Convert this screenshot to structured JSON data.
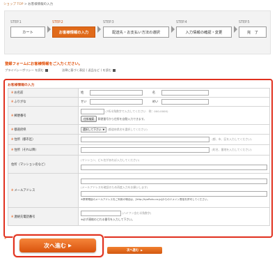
{
  "breadcrumb": {
    "home": "ショップ TOP",
    "separator": " > ",
    "current": "お客様情報の入力"
  },
  "steps": [
    {
      "num": "STEP.1",
      "label": "カート"
    },
    {
      "num": "STEP.2",
      "label": "お客様情報の入力"
    },
    {
      "num": "STEP.3",
      "label": "配送先・お支払い方法の選択"
    },
    {
      "num": "STEP.4",
      "label": "入力情報の確認・変更"
    },
    {
      "num": "STEP.5",
      "label": "完　了"
    }
  ],
  "intro": "登録フォームにお客様情報をご入力ください。",
  "links": {
    "privacy": "プライバシーポリシー を読む",
    "law": "法律に基づく表記 ( 返品など ) を読む"
  },
  "form": {
    "title": "お客様情報の入力",
    "required_mark": "※",
    "name": {
      "label": "お名前",
      "sei": "姓",
      "mei": "名"
    },
    "furigana": {
      "label": "ふりがな",
      "sei": "せい",
      "mei": "めい"
    },
    "zip": {
      "label": "郵便番号",
      "note": "(7桁半角数字で入力してください　例：000-0000)",
      "button": "住所検索",
      "button_note": "郵便番号から住所を自動入力できます。"
    },
    "pref": {
      "label": "都道府県",
      "select": "選択して下さい",
      "note": "(都道府県名を選択してください)"
    },
    "addr1": {
      "label": "住所（都市区）",
      "note": "(都、市、区を入力してください)"
    },
    "addr2": {
      "label": "住所（それ以降）",
      "note": "(町名、番地を入力してください)"
    },
    "building": {
      "label": "住所（マンション名など）",
      "note": "(マンション、ビル名があれば入力してください)"
    },
    "email": {
      "label": "メールアドレス",
      "note": "(メールアドレスを確認のため再度入力をお願いします)",
      "warning": "※携帯電話のメールアドレスをご利用の場合は、[http://kyoRoku.co.jp]からのドメイン受信を許可してください。"
    },
    "phone": {
      "label": "連絡先電話番号",
      "note": "(ハイフン含む半角数字)",
      "sub": "※必ず連絡のとれる番号を入力して下さい。"
    }
  },
  "buttons": {
    "next": "次へ進む"
  }
}
